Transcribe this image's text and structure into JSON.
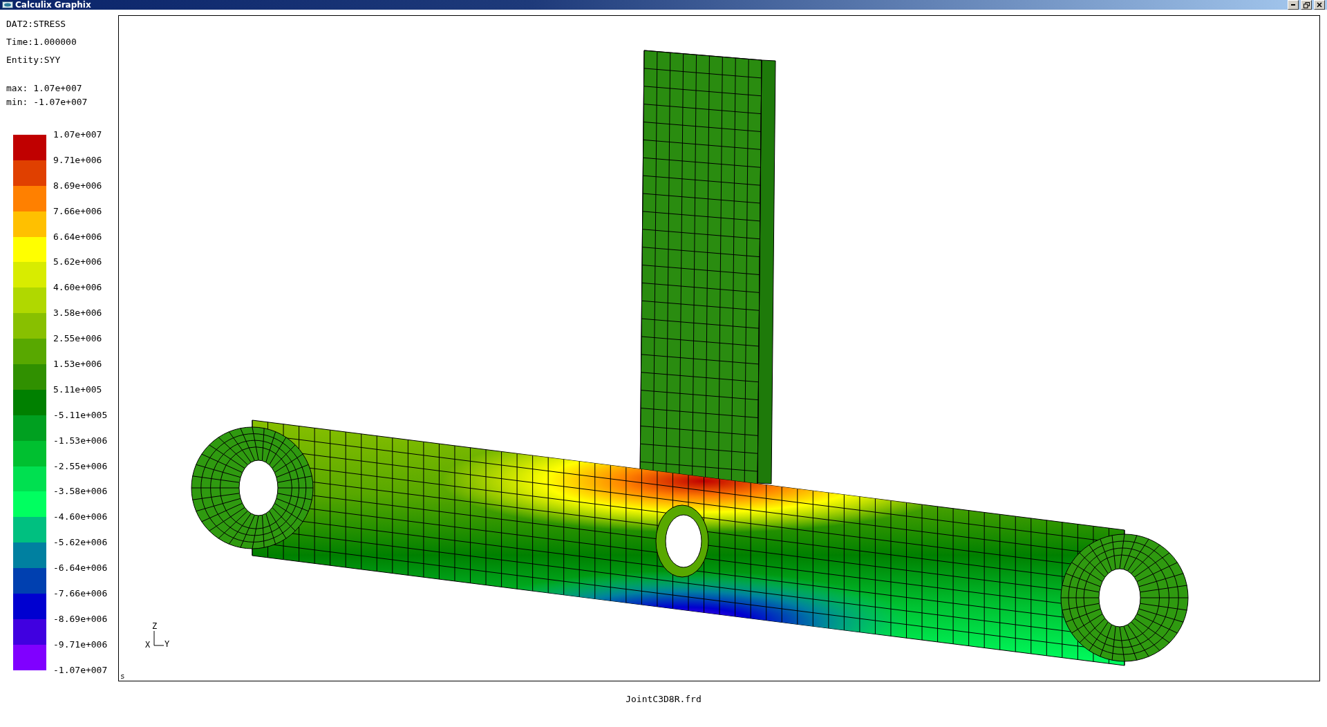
{
  "window": {
    "title": "Calculix Graphix"
  },
  "info": {
    "dataset": "DAT2:STRESS",
    "time": "Time:1.000000",
    "entity": "Entity:SYY",
    "max": "max: 1.07e+007",
    "min": "min: -1.07e+007"
  },
  "legend": {
    "labels": [
      "1.07e+007",
      "9.71e+006",
      "8.69e+006",
      "7.66e+006",
      "6.64e+006",
      "5.62e+006",
      "4.60e+006",
      "3.58e+006",
      "2.55e+006",
      "1.53e+006",
      "5.11e+005",
      "-5.11e+005",
      "-1.53e+006",
      "-2.55e+006",
      "-3.58e+006",
      "-4.60e+006",
      "-5.62e+006",
      "-6.64e+006",
      "-7.66e+006",
      "-8.69e+006",
      "-9.71e+006",
      "-1.07e+007"
    ],
    "bands": [
      {
        "color": "#c00000"
      },
      {
        "color": "#e04000"
      },
      {
        "color": "#ff8000"
      },
      {
        "color": "#ffc000"
      },
      {
        "color": "#ffff00"
      },
      {
        "color": "#d8ec00"
      },
      {
        "color": "#b0d800"
      },
      {
        "color": "#88c000"
      },
      {
        "color": "#58a800"
      },
      {
        "color": "#309000"
      },
      {
        "color": "#008000"
      },
      {
        "color": "#00a020"
      },
      {
        "color": "#00c030"
      },
      {
        "color": "#00e050"
      },
      {
        "color": "#00ff60"
      },
      {
        "color": "#00c080"
      },
      {
        "color": "#0080a0"
      },
      {
        "color": "#0040b0"
      },
      {
        "color": "#0000d0"
      },
      {
        "color": "#4000e0"
      },
      {
        "color": "#8000ff"
      }
    ]
  },
  "viewport": {
    "triad": {
      "z": "Z",
      "y": "Y",
      "x": "X"
    },
    "corner_mark": "s"
  },
  "filename": "JointC3D8R.frd"
}
